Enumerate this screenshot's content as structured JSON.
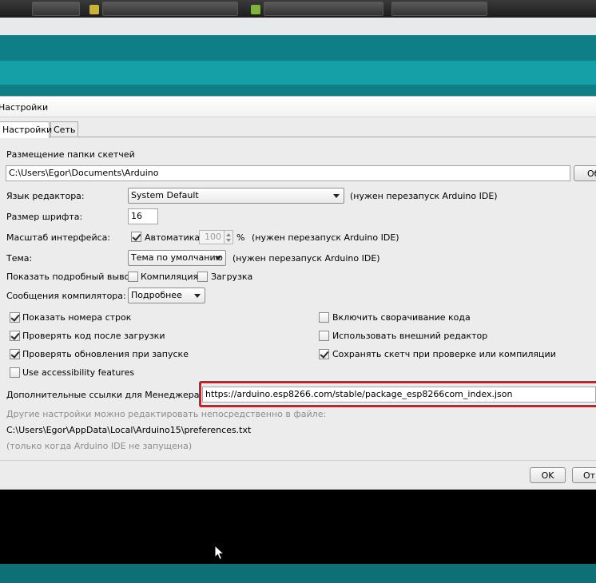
{
  "dialog": {
    "title": "Настройки",
    "tabs": [
      {
        "label": "Настройки",
        "active": true
      },
      {
        "label": "Сеть",
        "active": false
      }
    ],
    "sketchbook": {
      "label": "Размещение папки скетчей",
      "value": "C:\\Users\\Egor\\Documents\\Arduino",
      "browse_label": "Обзор"
    },
    "language": {
      "label": "Язык редактора:",
      "value": "System Default",
      "note": "(нужен перезапуск Arduino IDE)"
    },
    "font_size": {
      "label": "Размер шрифта:",
      "value": "16"
    },
    "scale": {
      "label": "Масштаб интерфейса:",
      "auto_label": "Автоматика",
      "auto_checked": true,
      "value": "100",
      "unit": "%",
      "note": "(нужен перезапуск Arduino IDE)"
    },
    "theme": {
      "label": "Тема:",
      "value": "Тема по умолчанию",
      "note": "(нужен перезапуск Arduino IDE)"
    },
    "verbose": {
      "label": "Показать подробный вывод:",
      "compile_label": "Компиляция",
      "compile_checked": false,
      "upload_label": "Загрузка",
      "upload_checked": false
    },
    "compiler_warnings": {
      "label": "Сообщения компилятора:",
      "value": "Подробнее"
    },
    "options_left": [
      {
        "label": "Показать номера строк",
        "checked": true
      },
      {
        "label": "Проверять код после загрузки",
        "checked": true
      },
      {
        "label": "Проверять обновления при запуске",
        "checked": true
      },
      {
        "label": "Use accessibility features",
        "checked": false
      }
    ],
    "options_right": [
      {
        "label": "Включить сворачивание кода",
        "checked": false
      },
      {
        "label": "Использовать внешний редактор",
        "checked": false
      },
      {
        "label": "Сохранять скетч при проверке или компиляции",
        "checked": true
      }
    ],
    "board_urls": {
      "label": "Дополнительные ссылки для Менеджера плат:",
      "value": "https://arduino.esp8266.com/stable/package_esp8266com_index.json"
    },
    "prefs_info": {
      "line1": "Другие настройки можно редактировать непосредственно в файле:",
      "path": "C:\\Users\\Egor\\AppData\\Local\\Arduino15\\preferences.txt",
      "line3": "(только когда Arduino IDE не запущена)"
    },
    "ok_label": "OK",
    "cancel_label": "Отмена"
  },
  "colors": {
    "highlight": "#e0161c",
    "ide_teal": "#0f7e86",
    "ide_toolbar": "#14a0a6"
  }
}
